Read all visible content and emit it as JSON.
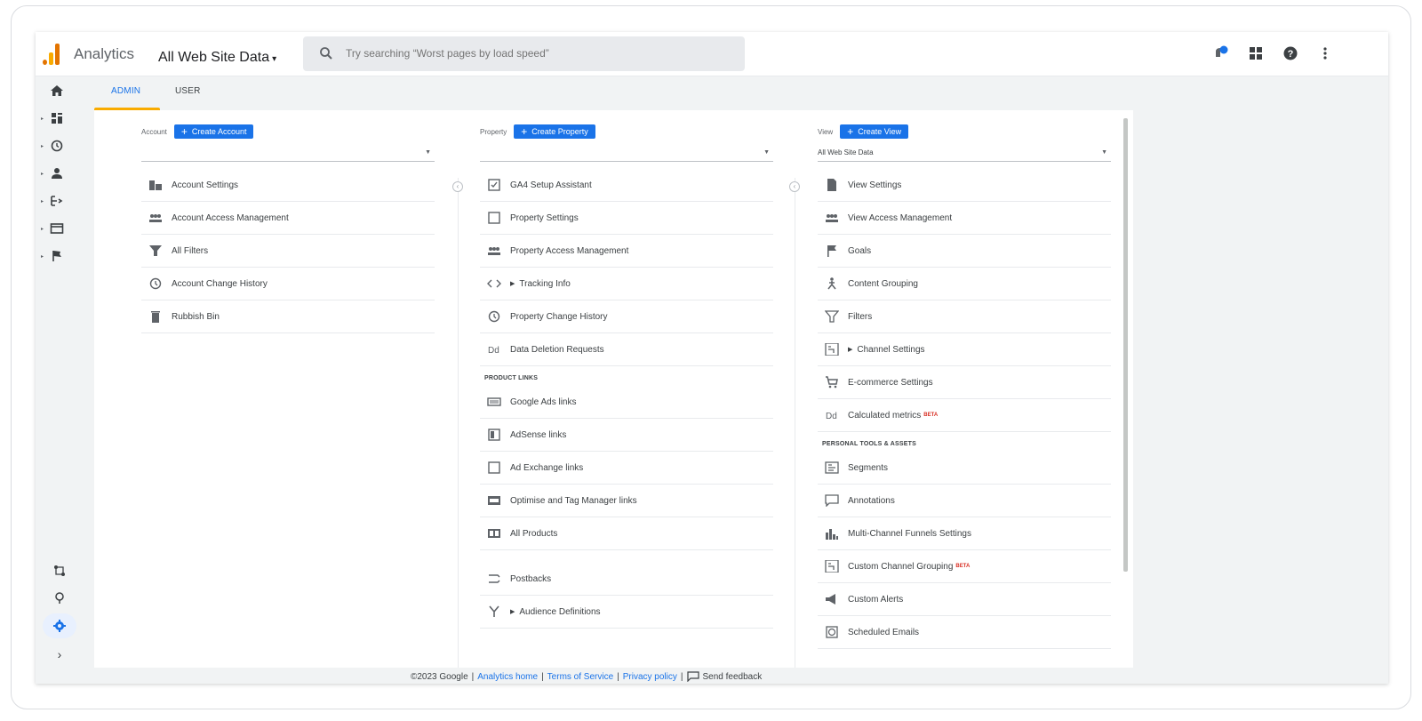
{
  "header": {
    "app_name": "Analytics",
    "property_name": "All Web Site Data",
    "search_placeholder": "Try searching “Worst pages by load speed”",
    "notification_count": "1",
    "brand_colors": {
      "orange": "#f9ab00",
      "dark_orange": "#e37400"
    }
  },
  "tabs": [
    {
      "label": "ADMIN",
      "active": true
    },
    {
      "label": "USER",
      "active": false
    }
  ],
  "nav": {
    "items": [
      "home-icon",
      "customization-icon",
      "realtime-icon",
      "audience-icon",
      "acquisition-icon",
      "behavior-icon",
      "conversions-icon"
    ],
    "bottom": [
      "attribution-icon",
      "discover-icon",
      "admin-gear-icon",
      "expand-icon"
    ]
  },
  "account": {
    "label": "Account",
    "create_button": "Create Account",
    "selected": "",
    "items": [
      {
        "icon": "building-icon",
        "label": "Account Settings"
      },
      {
        "icon": "people-icon",
        "label": "Account Access Management"
      },
      {
        "icon": "filter-icon",
        "label": "All Filters"
      },
      {
        "icon": "history-icon",
        "label": "Account Change History"
      },
      {
        "icon": "trash-icon",
        "label": "Rubbish Bin"
      }
    ]
  },
  "property": {
    "label": "Property",
    "create_button": "Create Property",
    "selected": "",
    "items": [
      {
        "icon": "checklist-icon",
        "label": "GA4 Setup Assistant"
      },
      {
        "icon": "square-icon",
        "label": "Property Settings"
      },
      {
        "icon": "people-icon",
        "label": "Property Access Management"
      },
      {
        "icon": "code-icon",
        "label": "Tracking Info",
        "expandable": true
      },
      {
        "icon": "history-icon",
        "label": "Property Change History"
      },
      {
        "icon": "dd-icon",
        "label": "Data Deletion Requests"
      }
    ],
    "product_links_title": "PRODUCT LINKS",
    "product_links": [
      {
        "icon": "google-ads-icon",
        "label": "Google Ads links"
      },
      {
        "icon": "adsense-icon",
        "label": "AdSense links"
      },
      {
        "icon": "ad-exchange-icon",
        "label": "Ad Exchange links"
      },
      {
        "icon": "optimise-icon",
        "label": "Optimise and Tag Manager links"
      },
      {
        "icon": "all-products-icon",
        "label": "All Products"
      }
    ],
    "extra_items": [
      {
        "icon": "postbacks-icon",
        "label": "Postbacks"
      },
      {
        "icon": "fork-icon",
        "label": "Audience Definitions",
        "expandable": true
      }
    ]
  },
  "view": {
    "label": "View",
    "create_button": "Create View",
    "selected": "All Web Site Data",
    "items": [
      {
        "icon": "document-icon",
        "label": "View Settings"
      },
      {
        "icon": "people-icon",
        "label": "View Access Management"
      },
      {
        "icon": "flag-icon",
        "label": "Goals"
      },
      {
        "icon": "person-walk-icon",
        "label": "Content Grouping"
      },
      {
        "icon": "filter-icon",
        "label": "Filters"
      },
      {
        "icon": "channel-icon",
        "label": "Channel Settings",
        "expandable": true
      },
      {
        "icon": "cart-icon",
        "label": "E-commerce Settings"
      },
      {
        "icon": "dd-icon",
        "label": "Calculated metrics",
        "badge": "BETA"
      }
    ],
    "personal_title": "PERSONAL TOOLS & ASSETS",
    "personal_items": [
      {
        "icon": "segments-icon",
        "label": "Segments"
      },
      {
        "icon": "comment-icon",
        "label": "Annotations"
      },
      {
        "icon": "bar-chart-icon",
        "label": "Multi-Channel Funnels Settings"
      },
      {
        "icon": "channel-icon",
        "label": "Custom Channel Grouping",
        "badge": "BETA"
      },
      {
        "icon": "megaphone-icon",
        "label": "Custom Alerts"
      },
      {
        "icon": "clock-icon",
        "label": "Scheduled Emails"
      }
    ]
  },
  "footer": {
    "copyright": "©2023 Google",
    "analytics_home": "Analytics home",
    "terms": "Terms of Service",
    "privacy": "Privacy policy",
    "feedback": "Send feedback",
    "separator": "|"
  }
}
